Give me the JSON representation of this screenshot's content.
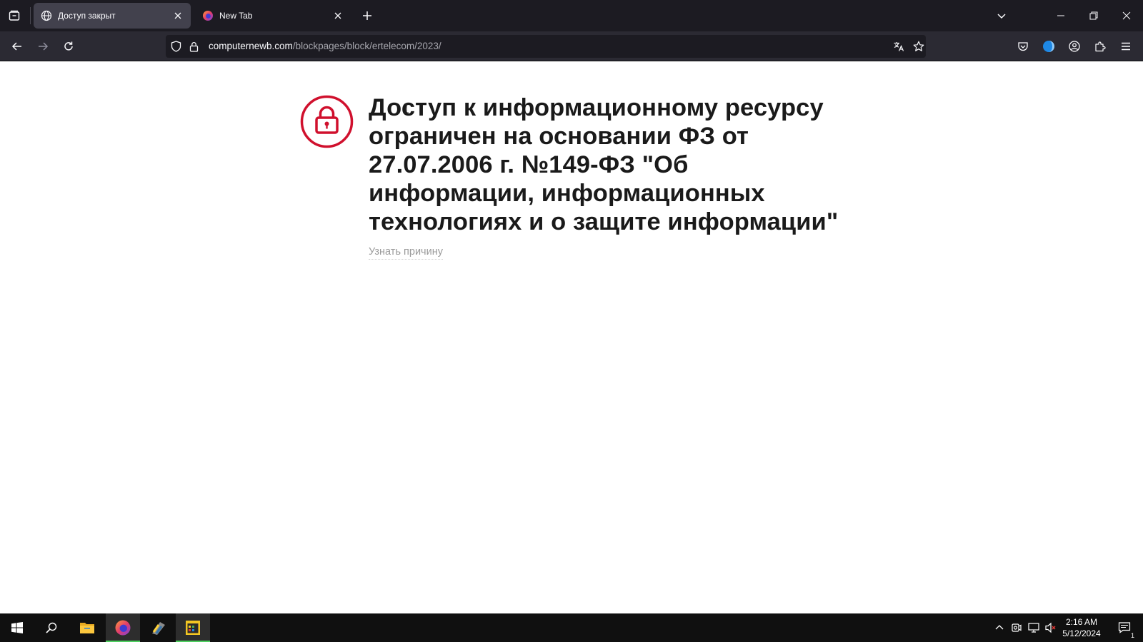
{
  "browser": {
    "tabs": [
      {
        "title": "Доступ закрыт",
        "icon": "globe-icon",
        "active": true
      },
      {
        "title": "New Tab",
        "icon": "firefox-icon",
        "active": false
      }
    ],
    "url": {
      "domain": "computernewb.com",
      "path": "/blockpages/block/ertelecom/2023/"
    }
  },
  "page": {
    "icon": "lock-icon",
    "heading": "Доступ к информационному ресурсу ограничен на основании ФЗ от 27.07.2006 г. №149-ФЗ \"Об информации, информационных технологиях и о защите информации\"",
    "reason_link": "Узнать причину",
    "accent_color": "#d0102d"
  },
  "taskbar": {
    "apps": [
      "windows-start-icon",
      "search-icon",
      "file-explorer-icon",
      "firefox-icon",
      "python-installer-icon",
      "app-window-icon"
    ],
    "clock": {
      "time": "2:16 AM",
      "date": "5/12/2024"
    },
    "notification_count": "1"
  }
}
